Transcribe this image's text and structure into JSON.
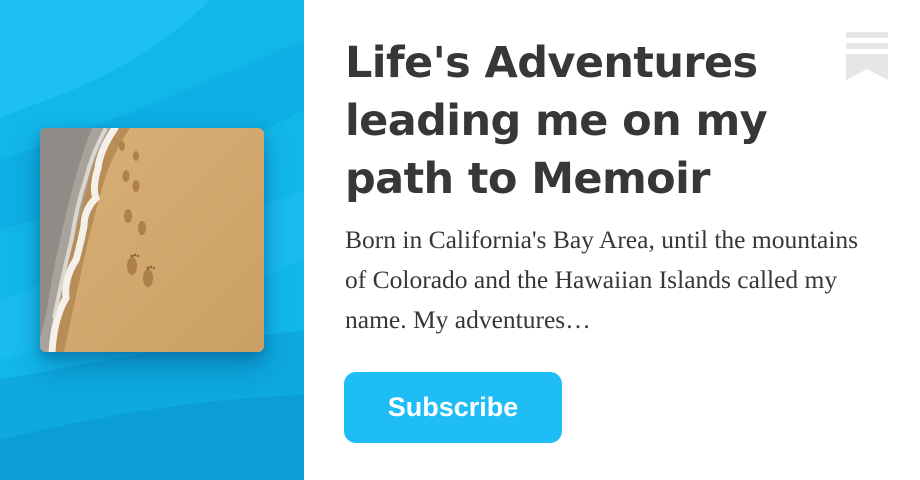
{
  "publication": {
    "title": "Life's Adventures leading me on my path to Memoir",
    "description": "Born in California's Bay Area, until the mountains of Colorado and the Hawaiian Islands called my name. My adventures…",
    "cover_icon": "beach-footprints-image",
    "logo_icon": "substack-bookmark-icon"
  },
  "actions": {
    "subscribe_label": "Subscribe"
  },
  "colors": {
    "accent": "#1ebdf5",
    "left_background": "#12b7ea",
    "title_text": "#363737",
    "logo_gray": "#e6e6e6"
  }
}
